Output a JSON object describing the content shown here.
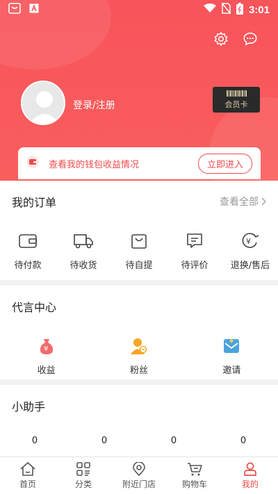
{
  "status_bar": {
    "time": "3:01"
  },
  "header": {
    "login_text": "登录/注册",
    "member_card_label": "会员卡",
    "wallet": {
      "text": "查看我的钱包收益情况",
      "button": "立即进入"
    }
  },
  "orders": {
    "title": "我的订单",
    "view_all": "查看全部",
    "items": [
      {
        "label": "待付款",
        "icon": "wallet-icon"
      },
      {
        "label": "待收货",
        "icon": "truck-icon"
      },
      {
        "label": "待自提",
        "icon": "bag-icon"
      },
      {
        "label": "待评价",
        "icon": "comment-icon"
      },
      {
        "label": "退换/售后",
        "icon": "refund-icon"
      }
    ]
  },
  "agent_center": {
    "title": "代言中心",
    "items": [
      {
        "label": "收益",
        "icon": "money-bag-icon"
      },
      {
        "label": "粉丝",
        "icon": "fans-icon"
      },
      {
        "label": "邀请",
        "icon": "invite-icon"
      }
    ]
  },
  "assistant": {
    "title": "小助手",
    "counts": [
      "0",
      "0",
      "0",
      "0"
    ]
  },
  "tabbar": {
    "items": [
      {
        "label": "首页",
        "icon": "home-icon"
      },
      {
        "label": "分类",
        "icon": "category-icon"
      },
      {
        "label": "附近门店",
        "icon": "location-icon"
      },
      {
        "label": "购物车",
        "icon": "cart-icon"
      },
      {
        "label": "我的",
        "icon": "profile-icon",
        "active": true
      }
    ]
  },
  "colors": {
    "brand": "#f8545b",
    "accent": "#f04b4b"
  }
}
